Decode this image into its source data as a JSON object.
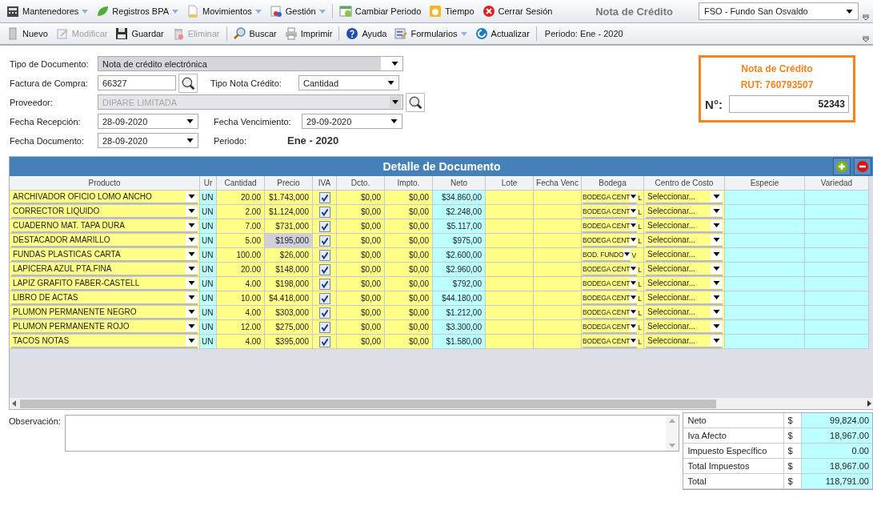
{
  "menu": [
    {
      "label": "Mantenedores",
      "dropdown": true
    },
    {
      "label": "Registros BPA",
      "dropdown": true
    },
    {
      "label": "Movimientos",
      "dropdown": true
    },
    {
      "label": "Gestión",
      "dropdown": true
    },
    {
      "label": "Cambiar Periodo",
      "dropdown": false
    },
    {
      "label": "Tiempo",
      "dropdown": false
    },
    {
      "label": "Cerrar Sesión",
      "dropdown": false
    }
  ],
  "page_title": "Nota de Crédito",
  "company_select": {
    "value": "FSO - Fundo San Osvaldo"
  },
  "toolbar": [
    {
      "label": "Nuevo",
      "disabled": false,
      "dropdown": false
    },
    {
      "label": "Modificar",
      "disabled": true,
      "dropdown": false
    },
    {
      "label": "Guardar",
      "disabled": false,
      "dropdown": false
    },
    {
      "label": "Eliminar",
      "disabled": true,
      "dropdown": false
    },
    {
      "label": "Buscar",
      "disabled": false,
      "dropdown": false
    },
    {
      "label": "Imprimir",
      "disabled": false,
      "dropdown": false
    },
    {
      "label": "Ayuda",
      "disabled": false,
      "dropdown": false
    },
    {
      "label": "Formularios",
      "disabled": false,
      "dropdown": true
    },
    {
      "label": "Actualizar",
      "disabled": false,
      "dropdown": false
    }
  ],
  "period_status": "Periodo: Ene - 2020",
  "form": {
    "tipo_documento": {
      "label": "Tipo de Documento:",
      "value": "Nota de crédito electrónica"
    },
    "factura_compra": {
      "label": "Factura de Compra:",
      "value": "66327"
    },
    "tipo_nota": {
      "label": "Tipo Nota Crédito:",
      "value": "Cantidad"
    },
    "proveedor": {
      "label": "Proveedor:",
      "value": "DIPARE LIMITADA",
      "disabled": true
    },
    "fecha_recepcion": {
      "label": "Fecha Recepción:",
      "value": "28-09-2020"
    },
    "fecha_vencimiento": {
      "label": "Fecha Vencimiento:",
      "value": "29-09-2020"
    },
    "fecha_documento": {
      "label": "Fecha Documento:",
      "value": "28-09-2020"
    },
    "periodo": {
      "label": "Periodo:",
      "value": "Ene - 2020"
    }
  },
  "doc_box": {
    "title": "Nota de Crédito",
    "rut": "RUT: 760793507",
    "number_label": "N°:",
    "number": "52343"
  },
  "detail": {
    "title": "Detalle de Documento",
    "columns": [
      "Producto",
      "Ur",
      "Cantidad",
      "Precio",
      "IVA",
      "Dcto.",
      "Impto.",
      "Neto",
      "Lote",
      "Fecha Venc",
      "Bodega",
      "Centro de Costo",
      "Especie",
      "Variedad"
    ],
    "rows": [
      {
        "producto": "ARCHIVADOR OFICIO LOMO ANCHO",
        "unidad": "UN",
        "cantidad": "20.00",
        "precio": "$1.743,000",
        "precio_focused": false,
        "iva": true,
        "dcto": "$0,00",
        "impto": "$0,00",
        "neto": "$34.860,00",
        "bodega": "BODEGA CENT",
        "bodega_tail": "L",
        "centro": "Seleccionar..."
      },
      {
        "producto": "CORRECTOR LIQUIDO",
        "unidad": "UN",
        "cantidad": "2.00",
        "precio": "$1.124,000",
        "precio_focused": false,
        "iva": true,
        "dcto": "$0,00",
        "impto": "$0,00",
        "neto": "$2.248,00",
        "bodega": "BODEGA CENT",
        "bodega_tail": "L",
        "centro": "Seleccionar..."
      },
      {
        "producto": "CUADERNO MAT. TAPA DURA",
        "unidad": "UN",
        "cantidad": "7.00",
        "precio": "$731,000",
        "precio_focused": false,
        "iva": true,
        "dcto": "$0,00",
        "impto": "$0,00",
        "neto": "$5.117,00",
        "bodega": "BODEGA CENT",
        "bodega_tail": "L",
        "centro": "Seleccionar..."
      },
      {
        "producto": "DESTACADOR AMARILLO",
        "unidad": "UN",
        "cantidad": "5.00",
        "precio": "$195,000",
        "precio_focused": true,
        "iva": true,
        "dcto": "$0,00",
        "impto": "$0,00",
        "neto": "$975,00",
        "bodega": "BODEGA CENT",
        "bodega_tail": "L",
        "centro": "Seleccionar..."
      },
      {
        "producto": "FUNDAS PLASTICAS CARTA",
        "unidad": "UN",
        "cantidad": "100.00",
        "precio": "$26,000",
        "precio_focused": false,
        "iva": true,
        "dcto": "$0,00",
        "impto": "$0,00",
        "neto": "$2.600,00",
        "bodega": "BOD. FUNDO",
        "bodega_tail": "V",
        "centro": "Seleccionar..."
      },
      {
        "producto": "LAPICERA AZUL PTA.FINA",
        "unidad": "UN",
        "cantidad": "20.00",
        "precio": "$148,000",
        "precio_focused": false,
        "iva": true,
        "dcto": "$0,00",
        "impto": "$0,00",
        "neto": "$2.960,00",
        "bodega": "BODEGA CENT",
        "bodega_tail": "L",
        "centro": "Seleccionar..."
      },
      {
        "producto": "LAPIZ GRAFITO FABER-CASTELL",
        "unidad": "UN",
        "cantidad": "4.00",
        "precio": "$198,000",
        "precio_focused": false,
        "iva": true,
        "dcto": "$0,00",
        "impto": "$0,00",
        "neto": "$792,00",
        "bodega": "BODEGA CENT",
        "bodega_tail": "L",
        "centro": "Seleccionar..."
      },
      {
        "producto": "LIBRO DE ACTAS",
        "unidad": "UN",
        "cantidad": "10.00",
        "precio": "$4.418,000",
        "precio_focused": false,
        "iva": true,
        "dcto": "$0,00",
        "impto": "$0,00",
        "neto": "$44.180,00",
        "bodega": "BODEGA CENT",
        "bodega_tail": "L",
        "centro": "Seleccionar..."
      },
      {
        "producto": "PLUMON PERMANENTE NEGRO",
        "unidad": "UN",
        "cantidad": "4.00",
        "precio": "$303,000",
        "precio_focused": false,
        "iva": true,
        "dcto": "$0,00",
        "impto": "$0,00",
        "neto": "$1.212,00",
        "bodega": "BODEGA CENT",
        "bodega_tail": "L",
        "centro": "Seleccionar..."
      },
      {
        "producto": "PLUMON PERMANENTE ROJO",
        "unidad": "UN",
        "cantidad": "12.00",
        "precio": "$275,000",
        "precio_focused": false,
        "iva": true,
        "dcto": "$0,00",
        "impto": "$0,00",
        "neto": "$3.300,00",
        "bodega": "BODEGA CENT",
        "bodega_tail": "L",
        "centro": "Seleccionar..."
      },
      {
        "producto": "TACOS NOTAS",
        "unidad": "UN",
        "cantidad": "4.00",
        "precio": "$395,000",
        "precio_focused": false,
        "iva": true,
        "dcto": "$0,00",
        "impto": "$0,00",
        "neto": "$1.580,00",
        "bodega": "BODEGA CENT",
        "bodega_tail": "L",
        "centro": "Seleccionar..."
      }
    ]
  },
  "observacion": {
    "label": "Observación:"
  },
  "totals": [
    {
      "label": "Neto",
      "currency": "$",
      "value": "99,824.00"
    },
    {
      "label": "Iva Afecto",
      "currency": "$",
      "value": "18,967.00"
    },
    {
      "label": "Impuesto Específico",
      "currency": "$",
      "value": "0.00"
    },
    {
      "label": "Total Impuestos",
      "currency": "$",
      "value": "18,967.00"
    },
    {
      "label": "Total",
      "currency": "$",
      "value": "118,791.00"
    }
  ]
}
